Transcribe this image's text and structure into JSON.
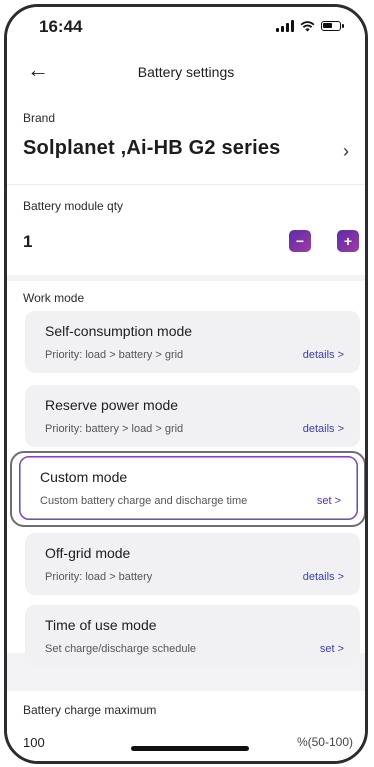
{
  "status": {
    "time": "16:44"
  },
  "nav": {
    "title": "Battery settings"
  },
  "brand": {
    "label": "Brand",
    "value": "Solplanet ,Ai-HB G2 series"
  },
  "qty": {
    "label": "Battery module qty",
    "value": "1",
    "minus": "−",
    "plus": "+"
  },
  "work_mode": {
    "label": "Work mode",
    "modes": [
      {
        "name": "Self-consumption mode",
        "desc": "Priority: load > battery > grid",
        "action": "details >"
      },
      {
        "name": "Reserve power mode",
        "desc": "Priority: battery > load > grid",
        "action": "details >"
      },
      {
        "name": "Custom mode",
        "desc": "Custom battery charge and discharge time",
        "action": "set >"
      },
      {
        "name": "Off-grid mode",
        "desc": "Priority: load > battery",
        "action": "details >"
      },
      {
        "name": "Time of use mode",
        "desc": "Set charge/discharge schedule",
        "action": "set >"
      }
    ]
  },
  "charge_max": {
    "label": "Battery charge maximum",
    "value": "100",
    "unit": "%(50-100)"
  },
  "icons": {
    "back": "arrow-left-icon",
    "chevron": "chevron-right-icon",
    "accent": "#7a33a8"
  }
}
